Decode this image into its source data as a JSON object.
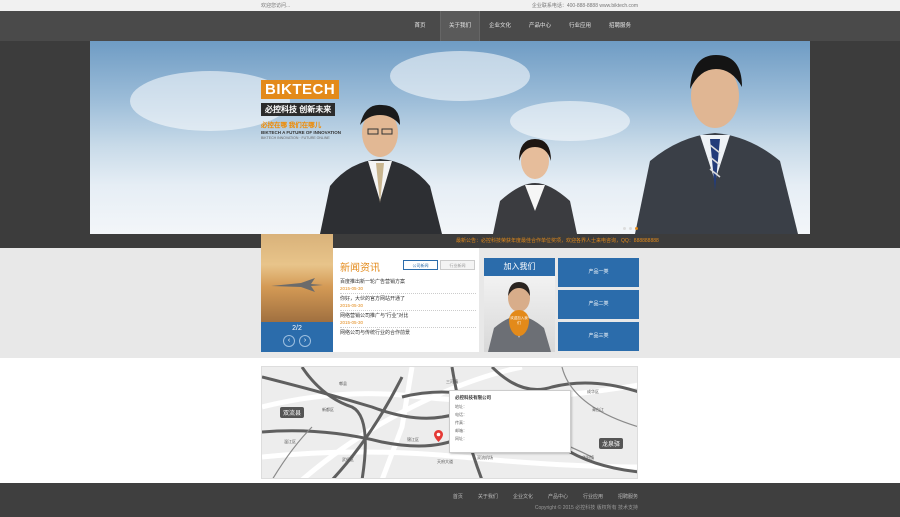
{
  "topbar": {
    "welcome": "欢迎您访问...",
    "contact": "企业联系电话：400-888-8888 www.biktech.com"
  },
  "nav": {
    "items": [
      "首页",
      "关于我们",
      "企业文化",
      "产品中心",
      "行业应用",
      "招聘服务"
    ],
    "active_index": 1
  },
  "hero": {
    "brand": "BIKTECH",
    "slogan": "必控科技  创新未来",
    "tagline": "必控在哪  我们在哪儿",
    "english": "BIKTECH A FUTURE OF INNOVATION",
    "english_sub": "BIKTECH INNOVATION · FUTURE ONLINE",
    "slide_count": 3,
    "active_slide": 2,
    "notice": "最新公告：必控科技荣获年度最佳合作单位奖项，欢迎各界人士来电咨询，QQ：888888888",
    "notice_icon": "speaker-icon"
  },
  "news": {
    "title": "新闻资讯",
    "tabs": [
      "公司新闻",
      "行业新闻"
    ],
    "pager": "2/2",
    "items": [
      {
        "title": "百度推出新一轮广告营销方案",
        "date": "2015-05-30"
      },
      {
        "title": "你好，大伙的官方网站开通了",
        "date": "2015-05-30"
      },
      {
        "title": "网络营销公司推广与“行业”对比",
        "date": "2015-05-30"
      },
      {
        "title": "网络公司与传统行业的合作前景",
        "date": ""
      }
    ]
  },
  "join": {
    "title": "加入我们",
    "badge": "欢迎加入我们"
  },
  "products": [
    "产品一类",
    "产品二类",
    "产品三类"
  ],
  "map": {
    "tags": [
      "双流县",
      "龙泉驿"
    ],
    "labels": [
      "郫县",
      "新都区",
      "三河镇",
      "成华区",
      "青白江",
      "温江区",
      "锦江区",
      "武侯区",
      "华阳镇",
      "天府大道",
      "双流机场"
    ],
    "card": {
      "title": "必控科技有限公司",
      "rows": [
        "地址：",
        "电话：",
        "传真：",
        "邮箱：",
        "网址："
      ]
    }
  },
  "footer": {
    "links": [
      "首页",
      "关于我们",
      "企业文化",
      "产品中心",
      "行业应用",
      "招聘服务"
    ],
    "copyright": "Copyright © 2015 必控科技 版权所有  技术支持"
  },
  "colors": {
    "accent_orange": "#e38a1a",
    "accent_blue": "#2b6cab",
    "nav_bg": "#4a4a4a",
    "footer_bg": "#3f3f3f"
  }
}
